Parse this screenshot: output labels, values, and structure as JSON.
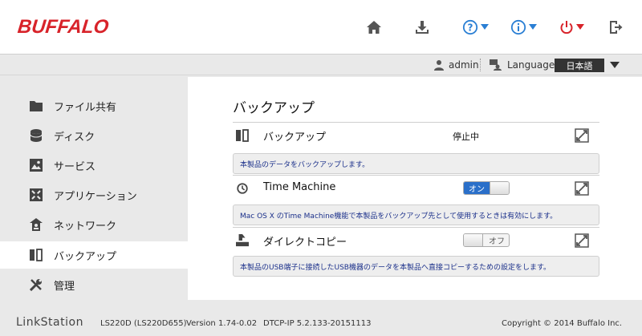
{
  "header": {
    "logo": "BUFFALO"
  },
  "userbar": {
    "user": "admin",
    "language_label": "Language",
    "language_value": "日本語"
  },
  "sidebar": {
    "items": [
      {
        "label": "ファイル共有",
        "icon": "folder-icon"
      },
      {
        "label": "ディスク",
        "icon": "disk-icon"
      },
      {
        "label": "サービス",
        "icon": "service-icon"
      },
      {
        "label": "アプリケーション",
        "icon": "application-icon"
      },
      {
        "label": "ネットワーク",
        "icon": "network-icon"
      },
      {
        "label": "バックアップ",
        "icon": "backup-icon"
      },
      {
        "label": "管理",
        "icon": "tools-icon"
      }
    ],
    "active_index": 5
  },
  "main": {
    "title": "バックアップ",
    "rows": [
      {
        "label": "バックアップ",
        "status": "停止中",
        "desc": "本製品のデータをバックアップします。"
      },
      {
        "label": "Time Machine",
        "toggle": "オン",
        "desc": "Mac OS X のTime Machine機能で本製品をバックアップ先として使用するときは有効にします。"
      },
      {
        "label": "ダイレクトコピー",
        "toggle": "オフ",
        "desc": "本製品のUSB端子に接続したUSB機器のデータを本製品へ直接コピーするための設定をします。"
      }
    ]
  },
  "footer": {
    "brand": "LinkStation",
    "model": "LS220D (LS220D655)",
    "version": "Version 1.74-0.02",
    "dtcp": "DTCP-IP 5.2.133-20151113",
    "copyright": "Copyright © 2014 Buffalo Inc."
  },
  "colors": {
    "brand_red": "#d8232a",
    "toggle_on": "#2a6fc9",
    "desc_text": "#1a2f8a",
    "power_red": "#d8232a",
    "help_blue": "#2a7fd4"
  }
}
